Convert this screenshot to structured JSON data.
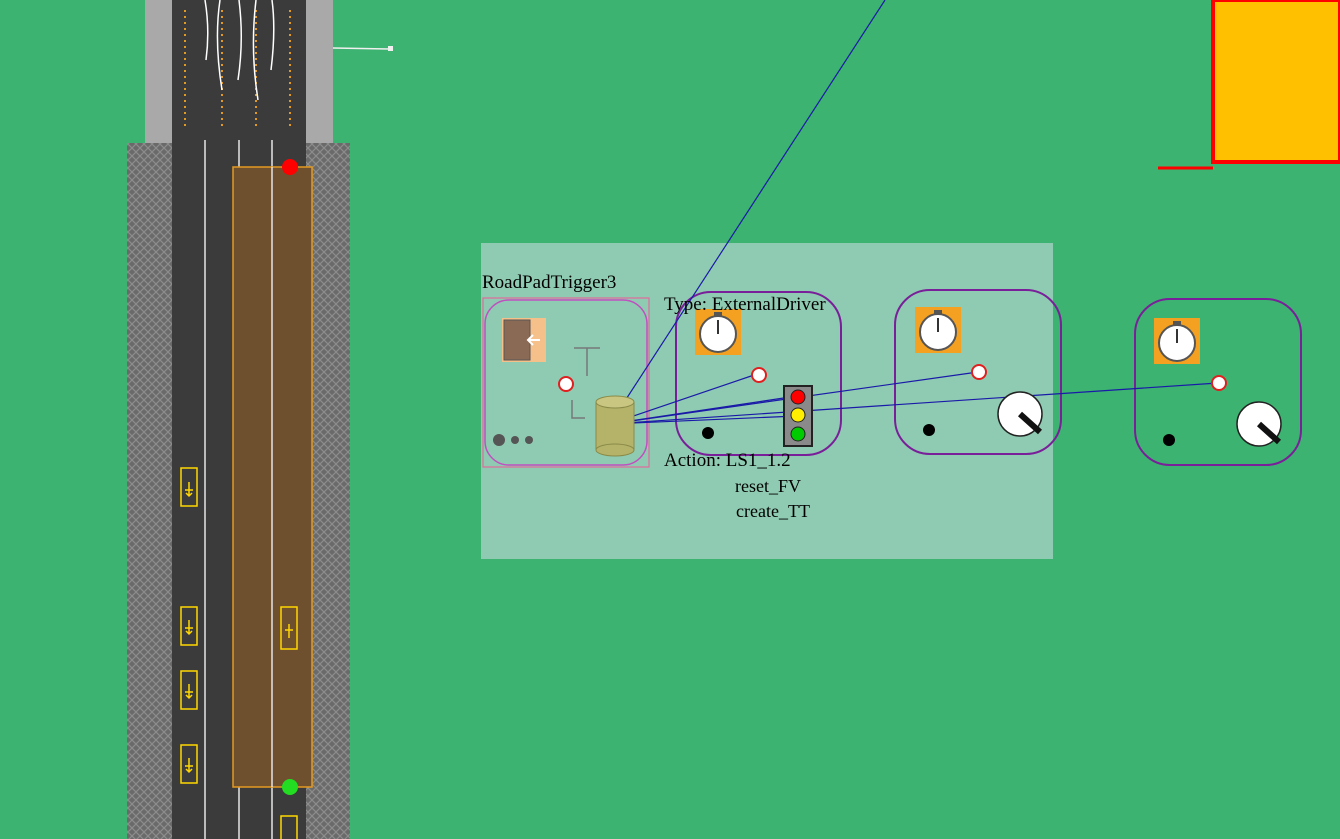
{
  "trigger": {
    "name": "RoadPadTrigger3",
    "type_label": "Type: ExternalDriver",
    "action_label": "Action: LS1_1.2",
    "actions": [
      "reset_FV",
      "create_TT"
    ]
  },
  "colors": {
    "ground": "#3cb371",
    "panel": "#8fcbb2",
    "asphalt": "#3b3b3b",
    "building": "#ffc000",
    "building_border": "#ff0000",
    "connection_line": "#1a1aa8",
    "group_border": "#7a1f9a",
    "pad_fill": "#6e4f2e"
  },
  "icons": {
    "stopwatch": "stopwatch-icon",
    "target": "target-marker-icon",
    "traffic_light": "traffic-light-icon",
    "gauge": "gauge-dial-icon",
    "database": "database-cylinder-icon",
    "vehicle": "vehicle-sensor-icon"
  }
}
